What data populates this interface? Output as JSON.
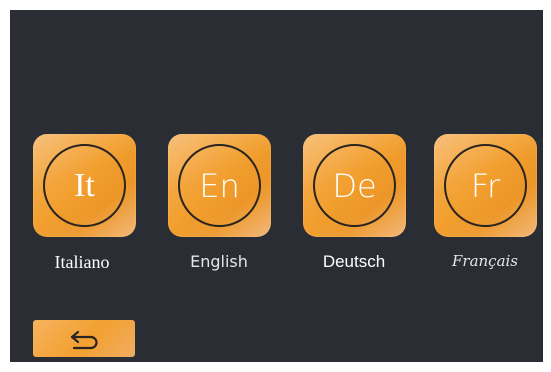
{
  "languages": [
    {
      "code": "It",
      "name": "Italiano"
    },
    {
      "code": "En",
      "name": "English"
    },
    {
      "code": "De",
      "name": "Deutsch"
    },
    {
      "code": "Fr",
      "name": "Français"
    }
  ],
  "back_button": {
    "icon": "return-arrow-icon"
  },
  "colors": {
    "background": "#2b2d35",
    "tile": "#f2a030",
    "ring": "#2a2420",
    "text": "#ffffff"
  }
}
